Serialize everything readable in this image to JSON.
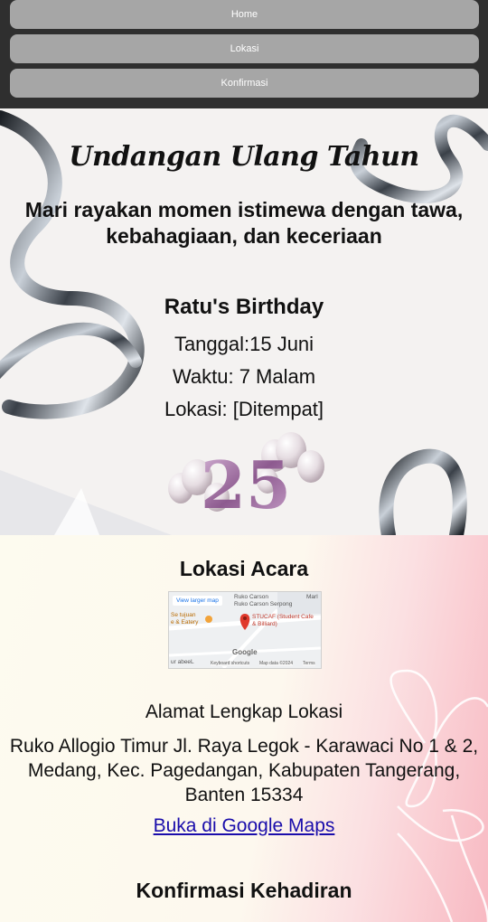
{
  "nav": {
    "items": [
      {
        "label": "Home"
      },
      {
        "label": "Lokasi"
      },
      {
        "label": "Konfirmasi"
      }
    ]
  },
  "hero": {
    "script_title": "Undangan Ulang Tahun",
    "tagline": "Mari rayakan momen istimewa dengan tawa, kebahagiaan, dan keceriaan",
    "name": "Ratu's Birthday",
    "date": "Tanggal:15 Juni",
    "time": "Waktu: 7 Malam",
    "place": "Lokasi: [Ditempat]",
    "balloon_number": "25"
  },
  "location": {
    "title": "Lokasi Acara",
    "map": {
      "view_larger": "View larger map",
      "place_top": "Ruko Carson",
      "place_top2": "Ruko Carson Serpong",
      "marl": "Marl",
      "se_tujuan": "Se tujuan",
      "eatery": "e & Eatery",
      "pin_label": "STUCAF (Student Cafe & Billiard)",
      "google": "Google",
      "ur_abeel": "ur abeeL",
      "shortcuts": "Keyboard shortcuts",
      "mapdata": "Map data ©2024",
      "terms": "Terms"
    },
    "address_heading": "Alamat Lengkap Lokasi",
    "address": "Ruko Allogio Timur Jl. Raya Legok - Karawaci No 1 & 2, Medang, Kec. Pagedangan, Kabupaten Tangerang, Banten 15334",
    "maps_link": "Buka di Google Maps"
  },
  "confirm": {
    "title": "Konfirmasi Kehadiran"
  }
}
